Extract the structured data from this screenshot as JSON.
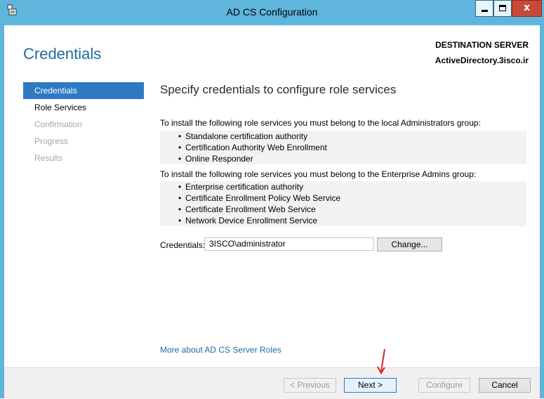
{
  "window": {
    "title": "AD CS Configuration"
  },
  "header": {
    "page_title": "Credentials",
    "destination_label": "DESTINATION SERVER",
    "destination_server": "ActiveDirectory.3isco.ir"
  },
  "nav": {
    "items": [
      {
        "label": "Credentials",
        "state": "active"
      },
      {
        "label": "Role Services",
        "state": "enabled"
      },
      {
        "label": "Confirmation",
        "state": "disabled"
      },
      {
        "label": "Progress",
        "state": "disabled"
      },
      {
        "label": "Results",
        "state": "disabled"
      }
    ]
  },
  "main": {
    "heading": "Specify credentials to configure role services",
    "admins_intro": "To install the following role services you must belong to the local Administrators group:",
    "admins_roles": [
      "Standalone certification authority",
      "Certification Authority Web Enrollment",
      "Online Responder"
    ],
    "enterprise_intro": "To install the following role services you must belong to the Enterprise Admins group:",
    "enterprise_roles": [
      "Enterprise certification authority",
      "Certificate Enrollment Policy Web Service",
      "Certificate Enrollment Web Service",
      "Network Device Enrollment Service"
    ],
    "credentials_label": "Credentials:",
    "credentials_value": "3ISCO\\administrator",
    "change_button": "Change...",
    "more_link": "More about AD CS Server Roles"
  },
  "footer": {
    "previous": "< Previous",
    "next": "Next >",
    "configure": "Configure",
    "cancel": "Cancel"
  },
  "colors": {
    "titlebar": "#5fb5dc",
    "accent": "#2d7ac3",
    "title_blue": "#1e6aa0",
    "annotation_arrow": "#e02020"
  }
}
